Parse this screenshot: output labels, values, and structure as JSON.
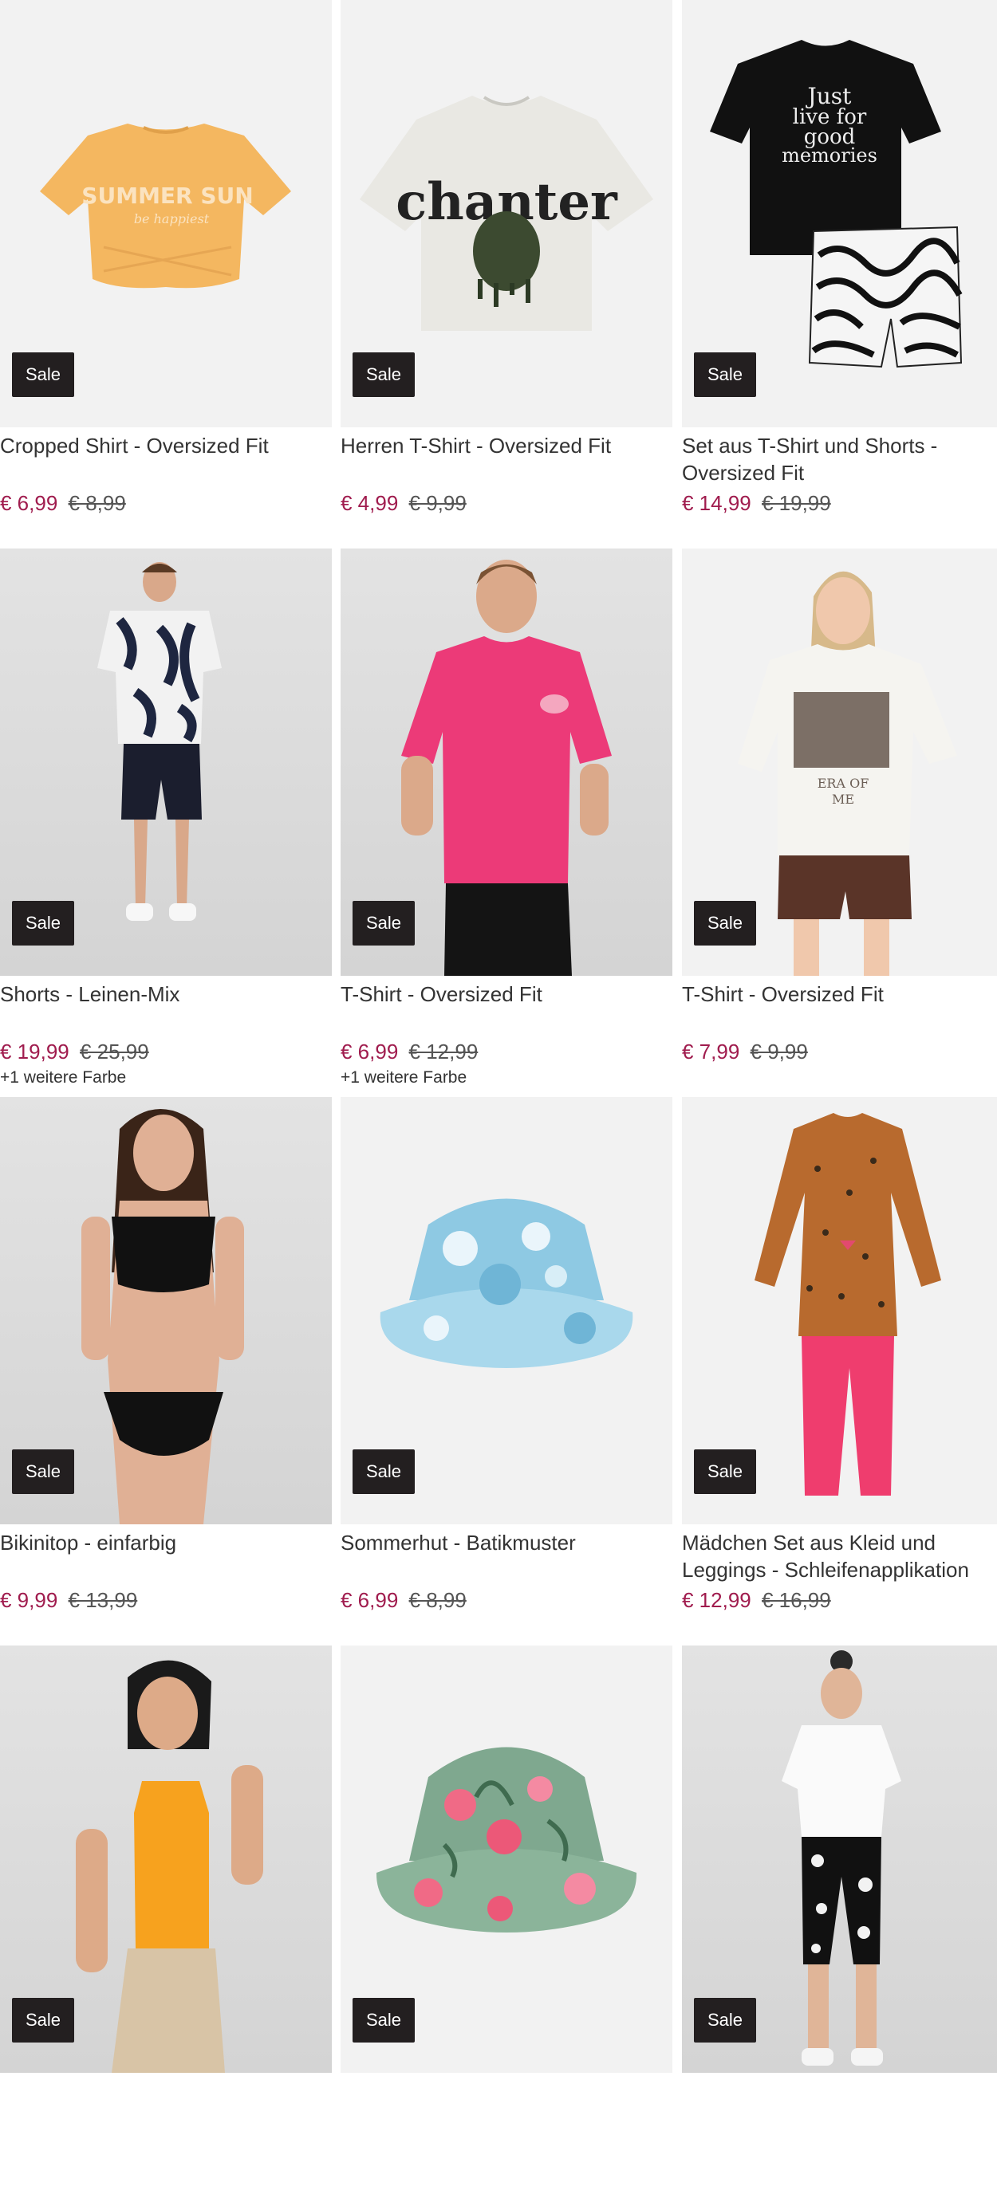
{
  "products": [
    {
      "title": "Cropped Shirt - Oversized Fit",
      "badge": "Sale",
      "price_now": "€ 6,99",
      "price_old": "€ 8,99",
      "colors_note": "",
      "image": "yellow-cropped-shirt"
    },
    {
      "title": "Herren T-Shirt - Oversized Fit",
      "badge": "Sale",
      "price_now": "€ 4,99",
      "price_old": "€ 9,99",
      "colors_note": "",
      "image": "white-tshirt-print"
    },
    {
      "title": "Set aus T-Shirt und Shorts - Oversized Fit",
      "badge": "Sale",
      "price_now": "€ 14,99",
      "price_old": "€ 19,99",
      "colors_note": "",
      "image": "black-tshirt-shorts-set"
    },
    {
      "title": "Shorts - Leinen-Mix",
      "badge": "Sale",
      "price_now": "€ 19,99",
      "price_old": "€ 25,99",
      "colors_note": "+1 weitere Farbe",
      "image": "model-linen-shorts"
    },
    {
      "title": "T-Shirt - Oversized Fit",
      "badge": "Sale",
      "price_now": "€ 6,99",
      "price_old": "€ 12,99",
      "colors_note": "+1 weitere Farbe",
      "image": "model-pink-tshirt"
    },
    {
      "title": "T-Shirt - Oversized Fit",
      "badge": "Sale",
      "price_now": "€ 7,99",
      "price_old": "€ 9,99",
      "colors_note": "",
      "image": "model-white-tshirt"
    },
    {
      "title": "Bikinitop - einfarbig",
      "badge": "Sale",
      "price_now": "€ 9,99",
      "price_old": "€ 13,99",
      "colors_note": "",
      "image": "model-black-bikini"
    },
    {
      "title": "Sommerhut - Batikmuster",
      "badge": "Sale",
      "price_now": "€ 6,99",
      "price_old": "€ 8,99",
      "colors_note": "",
      "image": "tie-dye-bucket-hat"
    },
    {
      "title": "Mädchen Set aus Kleid und Leggings - Schleifenapplikation",
      "badge": "Sale",
      "price_now": "€ 12,99",
      "price_old": "€ 16,99",
      "colors_note": "",
      "image": "girls-dress-leggings"
    },
    {
      "title": "",
      "badge": "Sale",
      "price_now": "",
      "price_old": "",
      "colors_note": "",
      "image": "model-orange-top"
    },
    {
      "title": "",
      "badge": "Sale",
      "price_now": "",
      "price_old": "",
      "colors_note": "",
      "image": "floral-bucket-hat"
    },
    {
      "title": "",
      "badge": "Sale",
      "price_now": "",
      "price_old": "",
      "colors_note": "",
      "image": "model-white-shirt-leggings"
    }
  ],
  "colors": {
    "sale_badge": "#231f20",
    "price_now": "#a01c4e",
    "image_bg": "#f2f2f2"
  }
}
